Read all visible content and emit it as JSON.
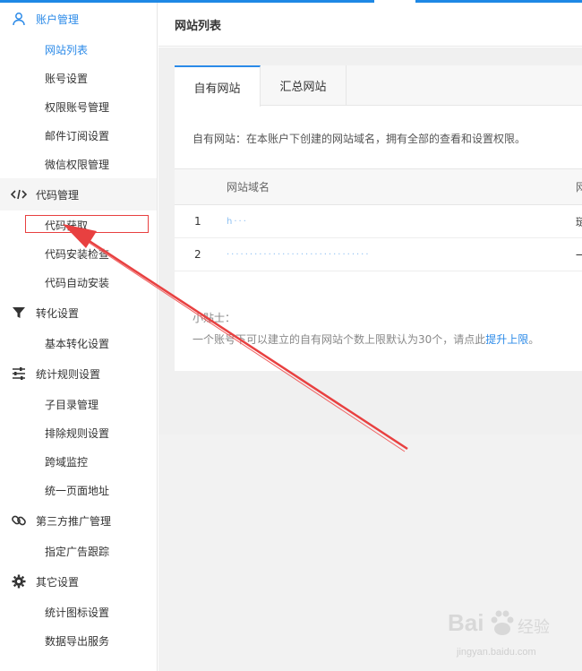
{
  "sidebar": {
    "groups": [
      {
        "label": "账户管理",
        "icon": "user-icon",
        "items": [
          "网站列表",
          "账号设置",
          "权限账号管理",
          "邮件订阅设置",
          "微信权限管理"
        ]
      },
      {
        "label": "代码管理",
        "icon": "code-icon",
        "items": [
          "代码获取",
          "代码安装检查",
          "代码自动安装"
        ]
      },
      {
        "label": "转化设置",
        "icon": "filter-icon",
        "items": [
          "基本转化设置"
        ]
      },
      {
        "label": "统计规则设置",
        "icon": "sliders-icon",
        "items": [
          "子目录管理",
          "排除规则设置",
          "跨域监控",
          "统一页面地址"
        ]
      },
      {
        "label": "第三方推广管理",
        "icon": "link-icon",
        "items": [
          "指定广告跟踪"
        ]
      },
      {
        "label": "其它设置",
        "icon": "gear-icon",
        "items": [
          "统计图标设置",
          "数据导出服务"
        ]
      }
    ]
  },
  "header": {
    "title": "网站列表"
  },
  "tabs": [
    "自有网站",
    "汇总网站"
  ],
  "description": "自有网站：在本账户下创建的网站域名，拥有全部的查看和设置权限。",
  "table": {
    "headers": [
      "网站域名",
      "网"
    ],
    "rows": [
      {
        "num": "1",
        "domain": "h···",
        "extra": "琏"
      },
      {
        "num": "2",
        "domain": "·······························",
        "extra": "一"
      }
    ]
  },
  "tips": {
    "title": "小贴士：",
    "text": "一个账号下可以建立的自有网站个数上限默认为30个，请点此",
    "link": "提升上限",
    "end": "。"
  },
  "watermark": {
    "brand": "Bai",
    "cn": "经验",
    "url": "jingyan.baidu.com"
  },
  "colors": {
    "accent": "#2b8ae8",
    "highlight": "#e84040"
  }
}
